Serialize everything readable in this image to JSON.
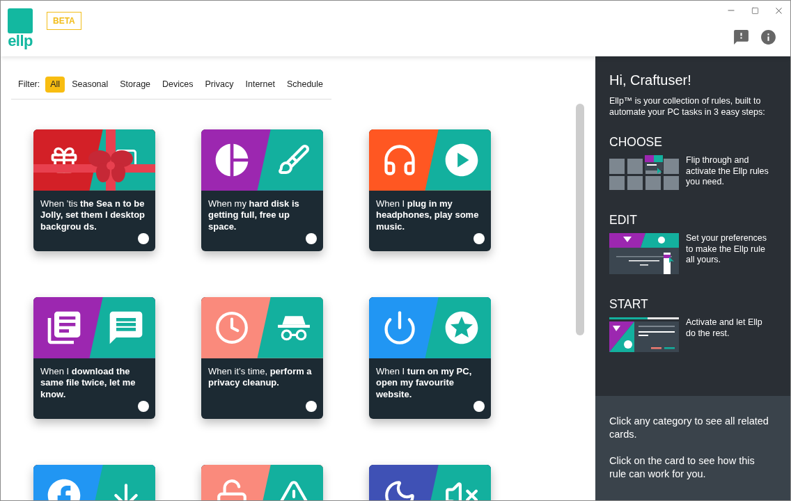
{
  "header": {
    "logo": "ellp",
    "badge": "BETA"
  },
  "filter": {
    "label": "Filter:",
    "options": [
      {
        "label": "All",
        "selected": true
      },
      {
        "label": "Seasonal",
        "selected": false
      },
      {
        "label": "Storage",
        "selected": false
      },
      {
        "label": "Devices",
        "selected": false
      },
      {
        "label": "Privacy",
        "selected": false
      },
      {
        "label": "Internet",
        "selected": false
      },
      {
        "label": "Schedule",
        "selected": false
      }
    ]
  },
  "cards": [
    {
      "color": "#d32027",
      "text": "When ’tis **the Sea n to be Jolly, set them l desktop backgrou ds.**"
    },
    {
      "color": "#9c27b0",
      "text": "When my **hard disk is getting full, free up space.**"
    },
    {
      "color": "#ff5722",
      "text": "When I **plug in my headphones, play some music.**"
    },
    {
      "color": "#9c27b0",
      "text": "When I **download the same file twice, let me know.**"
    },
    {
      "color": "#fa8a7c",
      "text": "When it’s time, **perform a privacy cleanup.**"
    },
    {
      "color": "#2196f3",
      "text": "When I **turn on my PC, open my favourite website.**"
    },
    {
      "color": "#2196f3"
    },
    {
      "color": "#fa8a7c"
    },
    {
      "color": "#3f51b5"
    }
  ],
  "panel": {
    "title": "Hi, Craftuser!",
    "intro": "Ellp™ is your collection of rules, built to automate your PC tasks in 3 easy steps:",
    "steps": [
      {
        "kind": "choose",
        "heading": "CHOOSE",
        "text": "Flip through and activate the Ellp rules you need."
      },
      {
        "kind": "edit",
        "heading": "EDIT",
        "text": "Set your preferences to make the Ellp rule all yours."
      },
      {
        "kind": "start",
        "heading": "START",
        "text": "Activate and let Ellp do the rest."
      }
    ],
    "tips": [
      "Click any category to see all related cards.",
      "Click on the card to see how this rule can work for you."
    ]
  }
}
